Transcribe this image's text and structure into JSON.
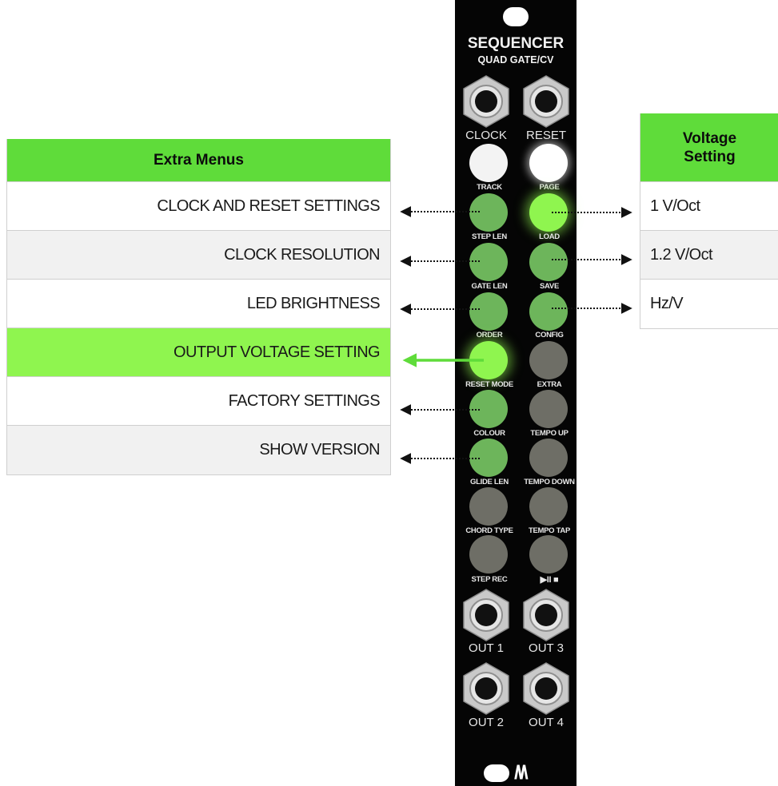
{
  "colors": {
    "header_green": "#5fdc3a",
    "highlight_green": "#8ff54f",
    "panel_black": "#050505"
  },
  "left_table": {
    "header": "Extra Menus",
    "rows": [
      "CLOCK AND RESET SETTINGS",
      "CLOCK RESOLUTION",
      "LED BRIGHTNESS",
      "OUTPUT VOLTAGE SETTING",
      "FACTORY SETTINGS",
      "SHOW VERSION"
    ],
    "highlighted_row": 3
  },
  "right_table": {
    "header_line1": "Voltage",
    "header_line2": "Setting",
    "rows": [
      "1 V/Oct",
      "1.2 V/Oct",
      "Hz/V"
    ]
  },
  "module": {
    "title": "SEQUENCER",
    "subtitle": "QUAD GATE/CV",
    "jacks_top": [
      "CLOCK",
      "RESET"
    ],
    "buttons": [
      {
        "label": "TRACK",
        "state": "white"
      },
      {
        "label": "PAGE",
        "state": "white-glow"
      },
      {
        "label": "STEP LEN",
        "state": "green"
      },
      {
        "label": "LOAD",
        "state": "green-glow"
      },
      {
        "label": "GATE LEN",
        "state": "green"
      },
      {
        "label": "SAVE",
        "state": "green"
      },
      {
        "label": "ORDER",
        "state": "green"
      },
      {
        "label": "CONFIG",
        "state": "green"
      },
      {
        "label": "RESET MODE",
        "state": "green-glow"
      },
      {
        "label": "EXTRA",
        "state": "grey"
      },
      {
        "label": "COLOUR",
        "state": "green"
      },
      {
        "label": "TEMPO UP",
        "state": "grey"
      },
      {
        "label": "GLIDE LEN",
        "state": "green"
      },
      {
        "label": "TEMPO DOWN",
        "state": "grey"
      },
      {
        "label": "CHORD TYPE",
        "state": "grey"
      },
      {
        "label": "TEMPO TAP",
        "state": "grey"
      },
      {
        "label": "STEP REC",
        "state": "grey"
      },
      {
        "label": "▶II ■",
        "state": "grey"
      }
    ],
    "jacks_bottom": [
      "OUT 1",
      "OUT 3",
      "OUT 2",
      "OUT 4"
    ],
    "logo_glyph": "/\\/\\"
  }
}
